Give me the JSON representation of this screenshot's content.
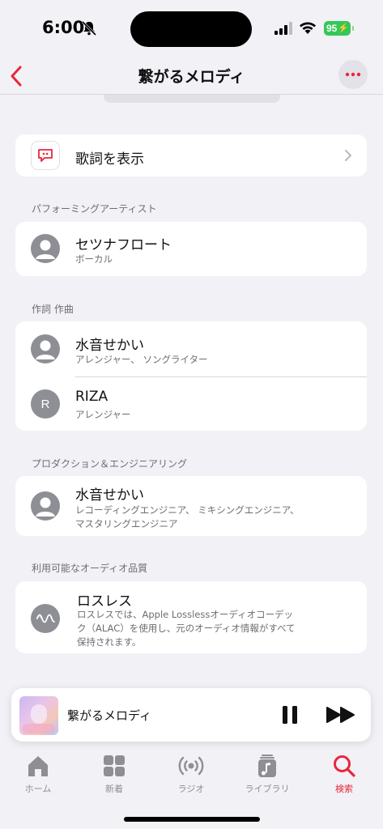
{
  "status_bar": {
    "time": "6:00",
    "battery": "95"
  },
  "nav": {
    "title": "繋がるメロディ"
  },
  "lyrics": {
    "label": "歌詞を表示"
  },
  "sections": {
    "performing": "パフォーミングアーティスト",
    "writing": "作詞 作曲",
    "production": "プロダクション＆エンジニアリング",
    "audio": "利用可能なオーディオ品質"
  },
  "performers": [
    {
      "name": "セツナフロート",
      "role": "ボーカル"
    }
  ],
  "writers": [
    {
      "name": "水音せかい",
      "role": "アレンジャー、 ソングライター"
    },
    {
      "name": "RIZA",
      "role": "アレンジャー",
      "initial": "R"
    }
  ],
  "production": [
    {
      "name": "水音せかい",
      "role_line1": "レコーディングエンジニア、 ミキシングエンジニア、",
      "role_line2": "マスタリングエンジニア"
    }
  ],
  "audio_quality": {
    "name": "ロスレス",
    "desc_line1": "ロスレスでは、Apple Losslessオーディオコーデッ",
    "desc_line2": "ク（ALAC）を使用し、元のオーディオ情報がすべて",
    "desc_line3": "保持されます。"
  },
  "mini_player": {
    "title": "繋がるメロディ"
  },
  "tabs": [
    {
      "label": "ホーム",
      "icon": "home-icon"
    },
    {
      "label": "新着",
      "icon": "grid-icon"
    },
    {
      "label": "ラジオ",
      "icon": "radio-icon"
    },
    {
      "label": "ライブラリ",
      "icon": "library-icon"
    },
    {
      "label": "検索",
      "icon": "search-icon",
      "active": true
    }
  ],
  "colors": {
    "accent": "#e9263c",
    "background": "#f2f1f6",
    "battery": "#34c759"
  }
}
